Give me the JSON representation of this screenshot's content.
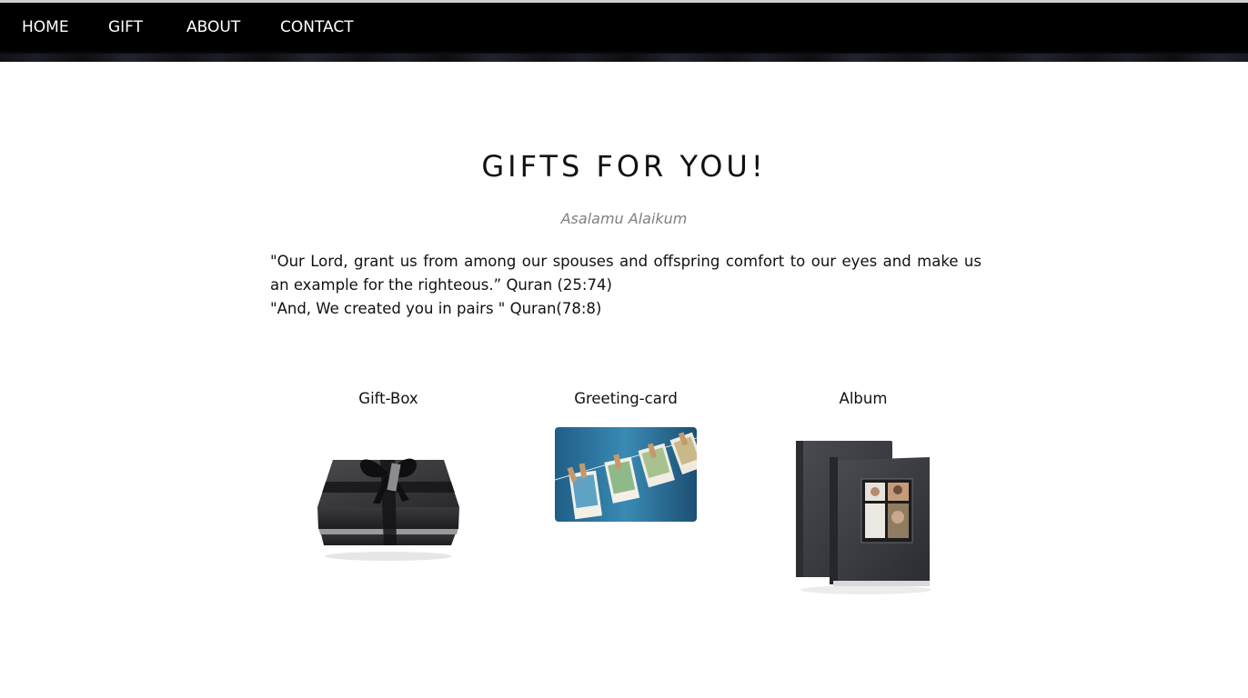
{
  "nav": {
    "items": [
      {
        "label": "HOME"
      },
      {
        "label": "GIFT"
      },
      {
        "label": "ABOUT"
      },
      {
        "label": "CONTACT"
      }
    ]
  },
  "main": {
    "title": "GIFTS FOR YOU!",
    "greeting": "Asalamu Alaikum",
    "quote_line1": "\"Our Lord, grant us from among our spouses and offspring comfort to our eyes and make us an example for the righteous.” Quran (25:74)",
    "quote_line2": "\"And, We created you in pairs \" Quran(78:8)"
  },
  "gifts": [
    {
      "label": "Gift-Box",
      "icon": "gift-box-image"
    },
    {
      "label": "Greeting-card",
      "icon": "greeting-card-image"
    },
    {
      "label": "Album",
      "icon": "photo-album-image"
    }
  ],
  "colors": {
    "navbar": "#000000",
    "nav_text": "#ffffff",
    "greeting": "#808080"
  }
}
